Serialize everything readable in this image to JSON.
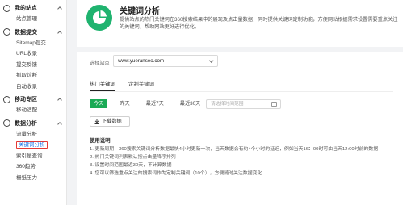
{
  "sidebar": {
    "sections": [
      {
        "title": "我的站点",
        "items": [
          "站点管理"
        ]
      },
      {
        "title": "数据提交",
        "items": [
          "Sitemap提交",
          "URL收录",
          "提交反馈",
          "抓取诊断",
          "自动收录"
        ]
      },
      {
        "title": "移动专区",
        "items": [
          "移动适配"
        ]
      },
      {
        "title": "数据分析",
        "items": [
          "流量分析",
          "关键词分析",
          "索引量查询",
          "360趋势",
          "栅纸压力"
        ]
      }
    ],
    "active_item": "关键词分析"
  },
  "header": {
    "title": "关键词分析",
    "description": "提供站点的热门关键词在360搜索结果中的展现及点击量数据，同时提供关键词定制功能，方便网站根据需求设置需要重点关注的关键词，帮助网站更好进行优化。"
  },
  "site_select": {
    "label": "选择站点",
    "value": "www.yueranseo.com"
  },
  "tabs": [
    "热门关键词",
    "定制关键词"
  ],
  "filters": [
    "今天",
    "昨天",
    "最近7天",
    "最近30天"
  ],
  "date_input": {
    "placeholder": "请选择时间范围"
  },
  "download_label": "下载数据",
  "notes": {
    "title": "使用说明",
    "items": [
      "1. 更新周期：360搜索关键词分析数据最快4小时更新一次，当天数据会有约4个小时的延迟，例如当天16：00时可由当天12:00时前的数据",
      "2. 热门关键词列表默认按点击量降序排列",
      "3. 设置时间范围最近30天，不计算数据",
      "4. 您可以筛选重点关注的搜索词作为定制关键词（10个），方便随时关注数据变化"
    ]
  },
  "colors": {
    "accent": "#1aaa55",
    "active_link": "#1a73e8",
    "highlight_border": "#e53935",
    "logo": "#1fb36f"
  }
}
